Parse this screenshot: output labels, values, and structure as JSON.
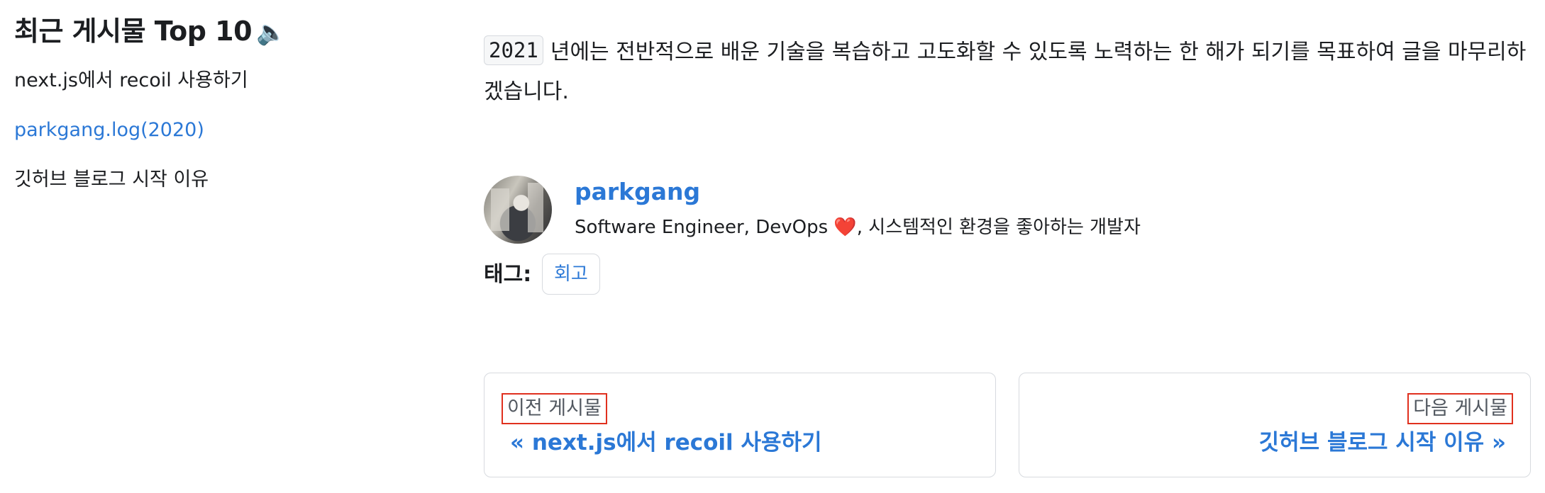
{
  "sidebar": {
    "title": "최근 게시물 Top 10",
    "title_icon": "🔈",
    "items": [
      {
        "label": "next.js에서 recoil 사용하기",
        "active": false
      },
      {
        "label": "parkgang.log(2020)",
        "active": true
      },
      {
        "label": "깃허브 블로그 시작 이유",
        "active": false
      }
    ]
  },
  "article": {
    "code": "2021",
    "text": "년에는 전반적으로 배운 기술을 복습하고 고도화할 수 있도록 노력하는 한 해가 되기를 목표하여 글을 마무리하겠습니다."
  },
  "author": {
    "name": "parkgang",
    "bio_prefix": "Software Engineer, DevOps",
    "bio_heart": "❤️",
    "bio_suffix": ", 시스템적인 환경을 좋아하는 개발자"
  },
  "tags": {
    "label": "태그:",
    "items": [
      "회고"
    ]
  },
  "pagination": {
    "prev": {
      "sublabel": "이전 게시물",
      "title": "« next.js에서 recoil 사용하기"
    },
    "next": {
      "sublabel": "다음 게시물",
      "title": "깃허브 블로그 시작 이유 »"
    }
  },
  "colors": {
    "link": "#2b78d6",
    "text": "#1c1e21",
    "highlight_box": "#e0301e",
    "heart": "#e0263b"
  }
}
